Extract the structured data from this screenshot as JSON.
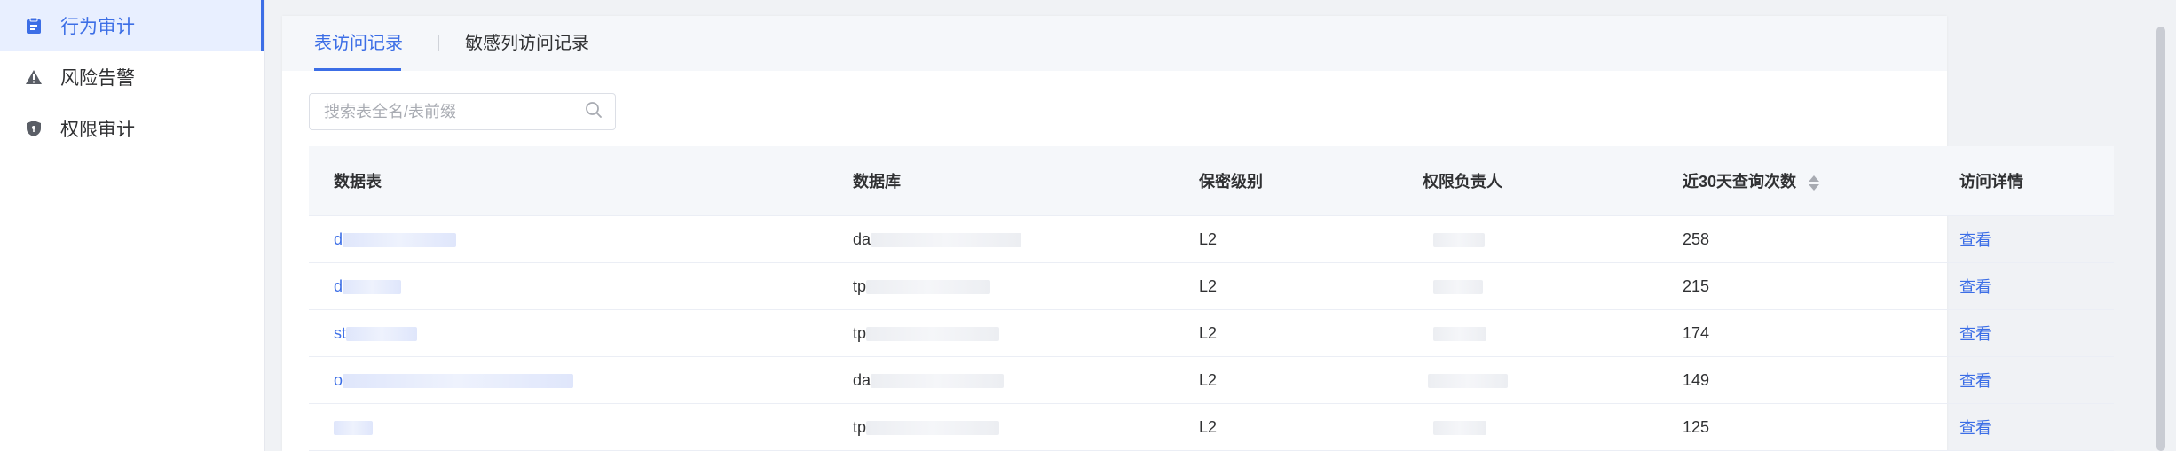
{
  "sidebar": {
    "items": [
      {
        "label": "行为审计",
        "icon": "clipboard-icon",
        "active": true
      },
      {
        "label": "风险告警",
        "icon": "warning-icon",
        "active": false
      },
      {
        "label": "权限审计",
        "icon": "shield-icon",
        "active": false
      }
    ]
  },
  "tabs": [
    {
      "label": "表访问记录",
      "active": true
    },
    {
      "label": "敏感列访问记录",
      "active": false
    }
  ],
  "search": {
    "placeholder": "搜索表全名/表前缀",
    "value": ""
  },
  "table": {
    "columns": [
      "数据表",
      "数据库",
      "保密级别",
      "权限负责人",
      "近30天查询次数",
      "访问详情"
    ],
    "rows": [
      {
        "table": "d",
        "database": "da",
        "level": "L2",
        "owner": "",
        "count": "258",
        "action": "查看"
      },
      {
        "table": "d",
        "database": "tp",
        "level": "L2",
        "owner": "",
        "count": "215",
        "action": "查看"
      },
      {
        "table": "st",
        "database": "tp",
        "level": "L2",
        "owner": "",
        "count": "174",
        "action": "查看"
      },
      {
        "table": "o",
        "database": "da",
        "level": "L2",
        "owner": "",
        "count": "149",
        "action": "查看"
      },
      {
        "table": "",
        "database": "tp",
        "level": "L2",
        "owner": "",
        "count": "125",
        "action": "查看"
      }
    ]
  },
  "colors": {
    "accent": "#3c6ee6",
    "active_bg": "#e8efff"
  }
}
